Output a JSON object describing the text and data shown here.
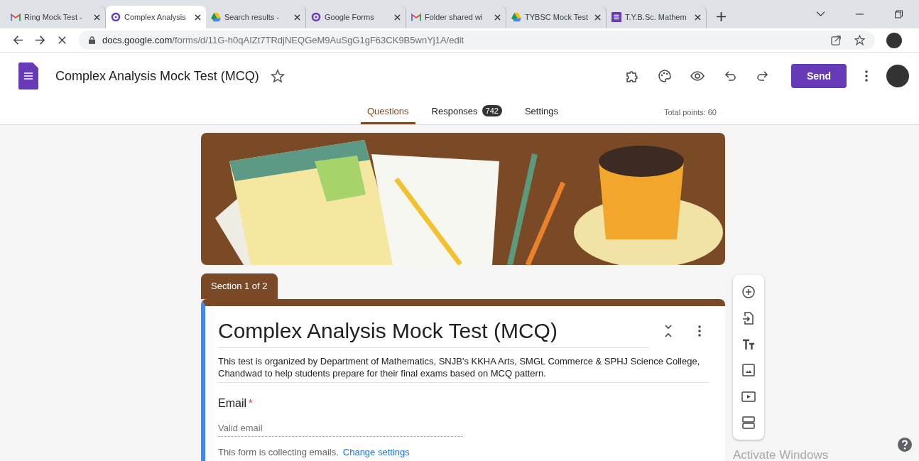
{
  "browser_tabs": [
    {
      "title": "Ring Mock Test -",
      "kind": "gmail",
      "selected": false
    },
    {
      "title": "Complex Analysis",
      "kind": "forms-alt",
      "selected": true
    },
    {
      "title": "Search results -",
      "kind": "drive",
      "selected": false
    },
    {
      "title": "Google Forms",
      "kind": "forms-alt",
      "selected": false
    },
    {
      "title": "Folder shared wi",
      "kind": "gmail",
      "selected": false
    },
    {
      "title": "TYBSC Mock Test",
      "kind": "drive",
      "selected": false
    },
    {
      "title": "T.Y.B.Sc. Mathem",
      "kind": "forms",
      "selected": false
    }
  ],
  "address_bar": {
    "host": "docs.google.com",
    "path": "/forms/d/11G-h0qAIZt7TRdjNEQGeM9AuSgG1gF63CK9B5wnYj1A/edit"
  },
  "form_header": {
    "title": "Complex Analysis Mock Test (MCQ)",
    "send_label": "Send"
  },
  "form_tabs": [
    {
      "label": "Questions",
      "selected": true
    },
    {
      "label": "Responses",
      "badge": "742",
      "selected": false
    },
    {
      "label": "Settings",
      "selected": false
    }
  ],
  "total_points": "Total points: 60",
  "section_tab": "Section 1 of 2",
  "form": {
    "title": "Complex Analysis Mock Test (MCQ)",
    "description": "This test is organized by Department of Mathematics, SNJB's KKHA Arts, SMGL Commerce & SPHJ Science College, Chandwad to help students prepare for their final exams based on MCQ pattern.",
    "email_label": "Email",
    "required_mark": "*",
    "email_placeholder": "Valid email",
    "collecting_note": "This form is collecting emails.",
    "change_settings": "Change settings"
  },
  "os_notice": "Activate Windows"
}
